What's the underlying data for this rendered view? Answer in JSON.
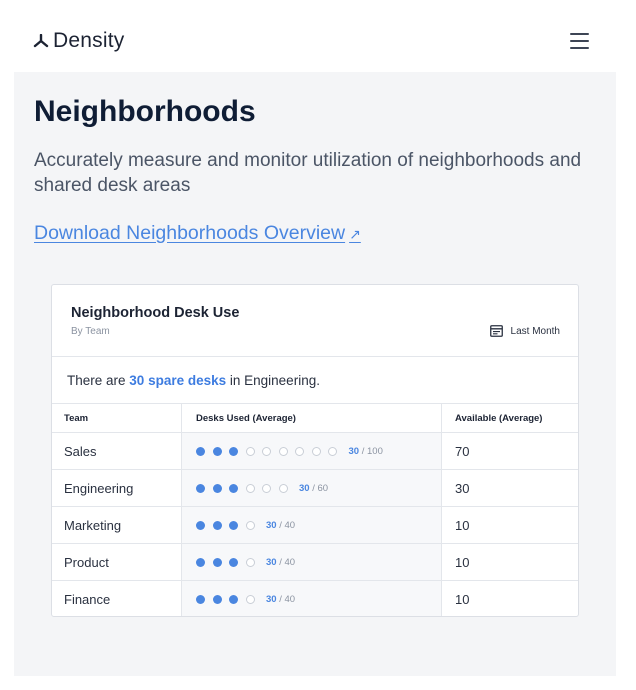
{
  "header": {
    "logo_text": "Density",
    "menu_icon": "hamburger-icon"
  },
  "page": {
    "title": "Neighborhoods",
    "subtitle": "Accurately measure and monitor utilization of neighborhoods and shared desk areas",
    "download_link": "Download Neighborhoods Overview",
    "link_icon": "↗"
  },
  "card": {
    "title": "Neighborhood Desk Use",
    "subtitle": "By Team",
    "period_label": "Last Month",
    "period_icon": "calendar-icon",
    "summary": {
      "prefix": "There are",
      "highlight": "30 spare desks",
      "suffix": "in Engineering."
    },
    "table": {
      "columns": [
        "Team",
        "Desks Used (Average)",
        "Available (Average)"
      ],
      "rows": [
        {
          "team": "Sales",
          "filled": 3,
          "empty": 6,
          "used": "30",
          "total": "/ 100",
          "available": "70"
        },
        {
          "team": "Engineering",
          "filled": 3,
          "empty": 3,
          "used": "30",
          "total": "/ 60",
          "available": "30"
        },
        {
          "team": "Marketing",
          "filled": 3,
          "empty": 1,
          "used": "30",
          "total": "/ 40",
          "available": "10"
        },
        {
          "team": "Product",
          "filled": 3,
          "empty": 1,
          "used": "30",
          "total": "/ 40",
          "available": "10"
        },
        {
          "team": "Finance",
          "filled": 3,
          "empty": 1,
          "used": "30",
          "total": "/ 40",
          "available": "10"
        }
      ]
    }
  },
  "colors": {
    "accent": "#4a86e0",
    "title": "#0f1d35",
    "background": "#f4f5f7"
  }
}
